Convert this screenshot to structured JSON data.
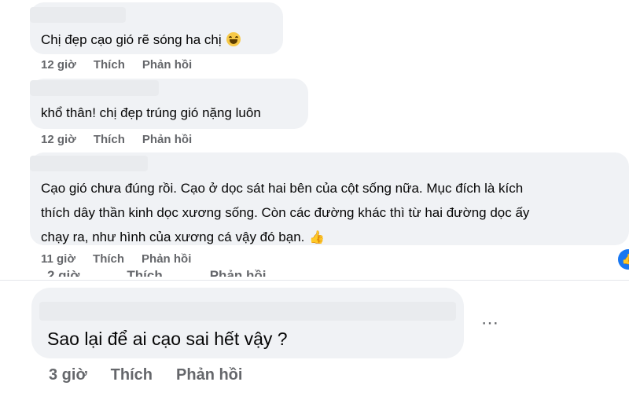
{
  "comments": [
    {
      "text": "Chị đẹp cạo gió rẽ sóng ha chị",
      "time": "12 giờ",
      "like": "Thích",
      "reply": "Phản hồi",
      "emoji": "laughing-face-icon"
    },
    {
      "text": "khổ thân! chị đẹp trúng gió nặng luôn",
      "time": "12 giờ",
      "like": "Thích",
      "reply": "Phản hồi"
    },
    {
      "lines": [
        "Cạo gió chưa đúng rồi. Cạo ở dọc sát hai bên của cột sống nữa. Mục đích là kích",
        "thích dây thần kinh dọc xương sống. Còn các đường khác thì từ hai đường dọc ấy",
        "chạy ra, như hình của xương cá vậy đó bạn."
      ],
      "time": "11 giờ",
      "like": "Thích",
      "reply": "Phản hồi",
      "emoji": "thumbs-up-icon"
    },
    {
      "text": "Sao lại để ai cạo sai hết vậy ?",
      "time": "3 giờ",
      "like": "Thích",
      "reply": "Phản hồi"
    }
  ],
  "cut_meta": {
    "time": "2 giờ",
    "like": "Thích",
    "reply": "Phản hồi"
  },
  "icons": {
    "more": "⋯",
    "thumb": "👍",
    "side_badge": "👍"
  },
  "colors": {
    "bubble": "#f0f2f5",
    "meta": "#65676b",
    "accent": "#1877f2"
  }
}
